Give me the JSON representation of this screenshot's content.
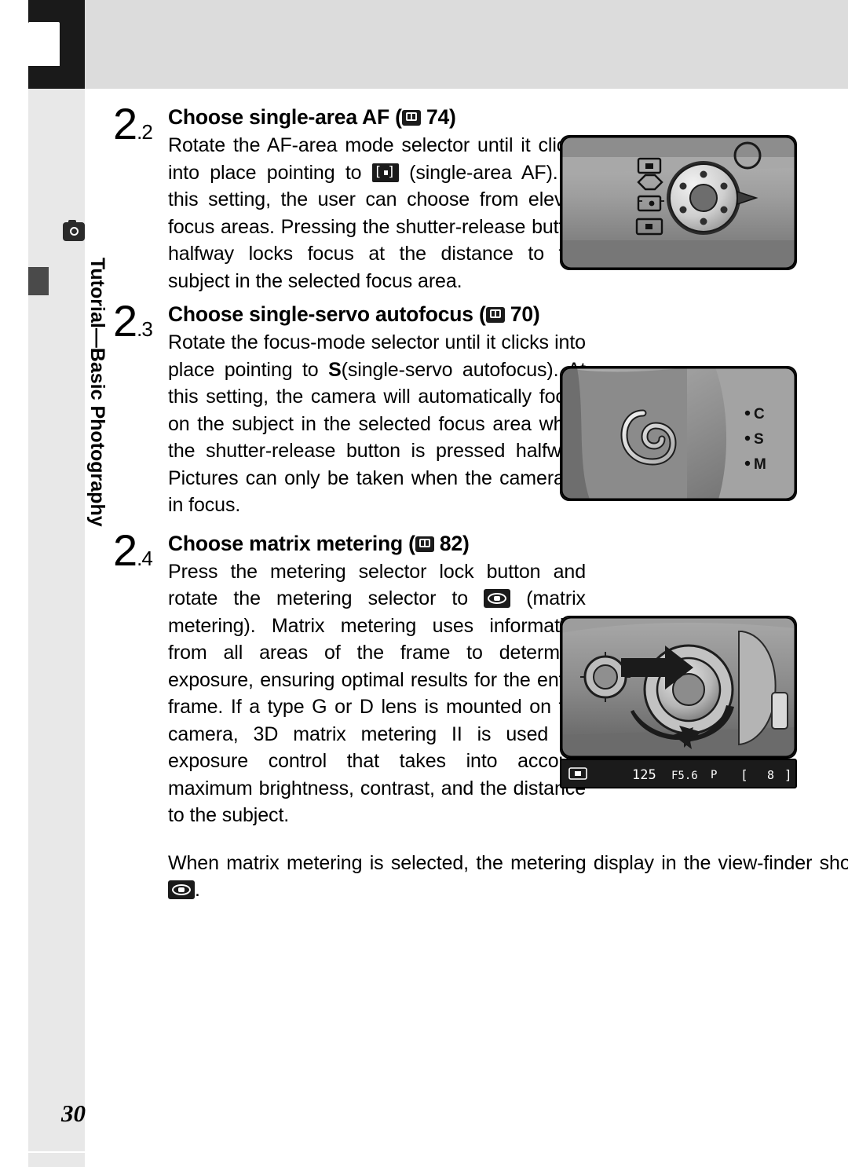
{
  "header": {
    "band_color": "#dcdcdc",
    "icon": "book-cover-icon"
  },
  "sidebar": {
    "chapter_label": "Tutorial—Basic Photography",
    "camera_icon": "camera-icon",
    "tab_marker": "chapter-tab-marker"
  },
  "steps": [
    {
      "number": "2",
      "substep": ".2",
      "title_pre": "Choose single-area AF (",
      "title_ref": "74",
      "title_post": ")",
      "body_parts": {
        "p1": "Rotate the AF-area mode selector until it clicks into place pointing to",
        "p2": "(single-area AF).  At this setting, the user can choose from eleven focus areas.  Pressing the shutter-release button halfway locks focus at the distance to the subject in the selected focus area."
      },
      "figure_name": "af-area-mode-selector-figure"
    },
    {
      "number": "2",
      "substep": ".3",
      "title_pre": "Choose single-servo autofocus (",
      "title_ref": "70",
      "title_post": ")",
      "body_parts": {
        "p1": "Rotate the focus-mode selector until it clicks into place pointing to",
        "icon": "S",
        "p2": "(single-servo autofocus).   At this setting, the camera will automatically focus on the subject in the selected focus area when the shutter-release button is pressed halfway.  Pictures can only be taken when the camera is in focus."
      },
      "figure_name": "focus-mode-selector-figure"
    },
    {
      "number": "2",
      "substep": ".4",
      "title_pre": "Choose matrix metering (",
      "title_ref": "82",
      "title_post": ")",
      "body_parts": {
        "p1": "Press the metering selector lock button and rotate the metering selector to",
        "p2": "(matrix metering).   Matrix metering uses information from all areas of the frame to determine exposure, ensuring optimal results for the entire frame.  If a type G or D lens is mounted on the camera, 3D matrix metering II is used for exposure control that takes into account maximum brightness, contrast, and the distance to the subject."
      },
      "figure_name": "metering-selector-figure"
    }
  ],
  "note": {
    "p1": "When matrix metering is selected, the metering display in the view-finder shows",
    "p2": "."
  },
  "viewfinder": {
    "display": "125  F5.6  P        [    8 ]",
    "shutter_speed": "125",
    "aperture": "F5.6",
    "mode": "P",
    "frames_remaining": "8"
  },
  "focus_mode_dial": {
    "options": [
      "C",
      "S",
      "M"
    ]
  },
  "page_number": "30"
}
